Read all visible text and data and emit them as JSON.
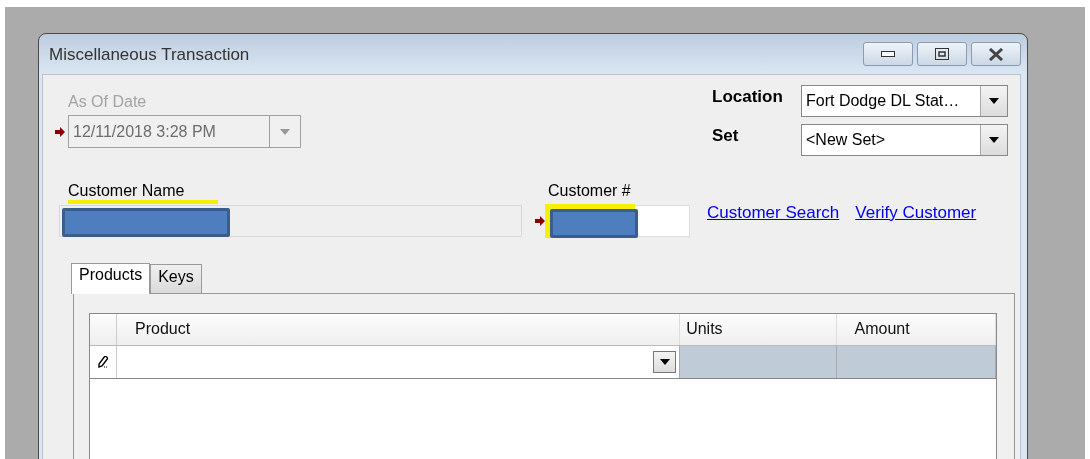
{
  "window": {
    "title": "Miscellaneous Transaction"
  },
  "as_of_date": {
    "label": "As Of Date",
    "value": "12/11/2018 3:28 PM",
    "disabled": true,
    "required": true
  },
  "location": {
    "label": "Location",
    "value": "Fort Dodge DL Stat…"
  },
  "set": {
    "label": "Set",
    "value": "<New Set>"
  },
  "customer_name": {
    "label": "Customer Name",
    "required": false
  },
  "customer_number": {
    "label": "Customer #",
    "required": true
  },
  "links": [
    "Customer Search",
    "Verify Customer"
  ],
  "tabs": [
    {
      "label": "Products",
      "selected": true
    },
    {
      "label": "Keys",
      "selected": false
    }
  ],
  "grid": {
    "columns": [
      "Product",
      "Units",
      "Amount"
    ]
  }
}
